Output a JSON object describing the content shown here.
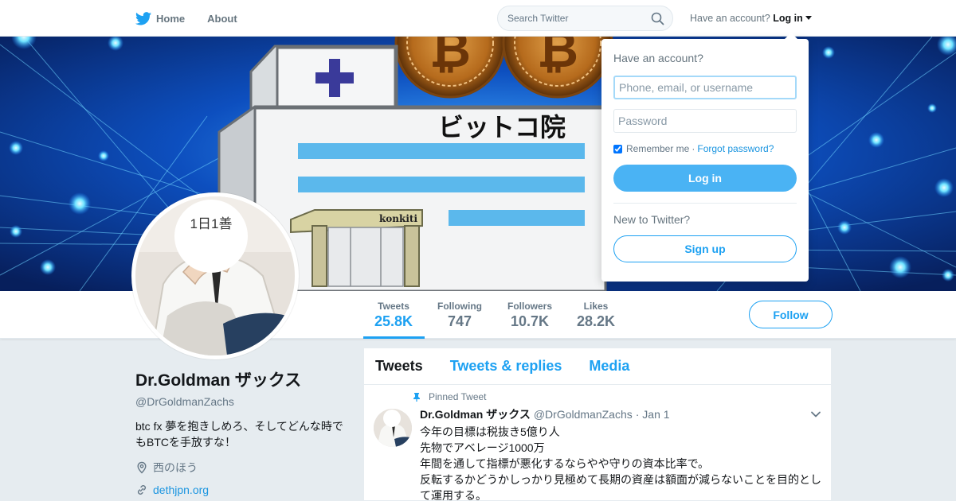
{
  "nav": {
    "home_label": "Home",
    "about_label": "About",
    "search_placeholder": "Search Twitter",
    "have_account_text": "Have an account?",
    "login_label": "Log in"
  },
  "banner": {
    "building_sign": "ビットコ院",
    "shop_sign": "konkiti",
    "coin_glyph": "₿"
  },
  "profile": {
    "avatar_caption": "1日1善",
    "display_name": "Dr.Goldman ザックス",
    "handle": "@DrGoldmanZachs",
    "bio": "btc fx 夢を抱きしめろ、そしてどんな時でもBTCを手放すな！",
    "location": "西のほう",
    "website": "dethjpn.org",
    "follow_label": "Follow"
  },
  "stats": [
    {
      "label": "Tweets",
      "value": "25.8K"
    },
    {
      "label": "Following",
      "value": "747"
    },
    {
      "label": "Followers",
      "value": "10.7K"
    },
    {
      "label": "Likes",
      "value": "28.2K"
    }
  ],
  "timeline": {
    "tabs": [
      "Tweets",
      "Tweets & replies",
      "Media"
    ],
    "tweet": {
      "pinned_label": "Pinned Tweet",
      "name": "Dr.Goldman ザックス",
      "handle": "@DrGoldmanZachs",
      "date": "· Jan 1",
      "lines": [
        "今年の目標は税抜き5億り人",
        "先物でアベレージ1000万",
        "年間を通して指標が悪化するならやや守りの資本比率で。",
        "反転するかどうかしっかり見極めて長期の資産は額面が減らないことを目的として運用する。"
      ]
    }
  },
  "login_dropdown": {
    "heading": "Have an account?",
    "username_placeholder": "Phone, email, or username",
    "password_placeholder": "Password",
    "remember_label": "Remember me",
    "separator": "·",
    "forgot_label": "Forgot password?",
    "login_button": "Log in",
    "new_heading": "New to Twitter?",
    "signup_button": "Sign up"
  },
  "colors": {
    "accent": "#1da1f2",
    "banner_blue": "#0c3a8f",
    "login_button": "#4ab3f4"
  }
}
